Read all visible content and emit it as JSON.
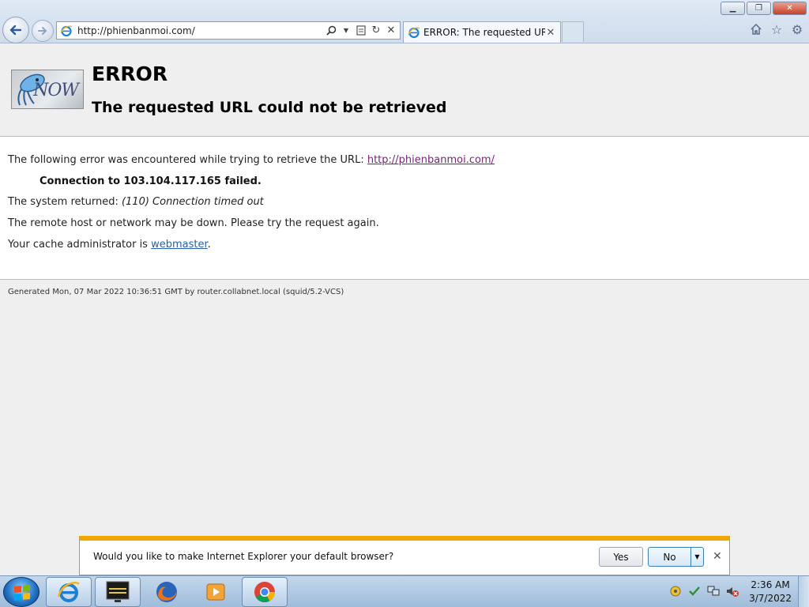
{
  "browser": {
    "address_url": "http://phienbanmoi.com/",
    "tab_title": "ERROR: The requested URL ...",
    "icons": {
      "back": "back-arrow-icon",
      "forward": "forward-arrow-icon",
      "search": "search-icon",
      "compat": "compatibility-view-icon",
      "refresh": "refresh-icon",
      "stop": "stop-icon",
      "home": "home-icon",
      "favorites": "star-icon",
      "tools": "gear-icon"
    }
  },
  "page": {
    "logo_text": "NOW",
    "title": "ERROR",
    "subtitle": "The requested URL could not be retrieved",
    "p1_prefix": "The following error was encountered while trying to retrieve the URL: ",
    "p1_link": "http://phienbanmoi.com/",
    "failed": "Connection to 103.104.117.165 failed.",
    "p3_prefix": "The system returned: ",
    "p3_error": "(110) Connection timed out",
    "p4": "The remote host or network may be down. Please try the request again.",
    "p5_prefix": "Your cache administrator is ",
    "p5_link": "webmaster",
    "p5_suffix": ".",
    "footer": "Generated Mon, 07 Mar 2022 10:36:51 GMT by router.collabnet.local (squid/5.2-VCS)"
  },
  "notification": {
    "message": "Would you like to make Internet Explorer your default browser?",
    "yes_label": "Yes",
    "no_label": "No",
    "accent_color": "#f0a800"
  },
  "taskbar": {
    "apps": [
      "internet-explorer-icon",
      "cmd-app-icon",
      "firefox-icon",
      "media-player-icon",
      "chrome-icon"
    ],
    "clock_time": "2:36 AM",
    "clock_date": "3/7/2022"
  }
}
